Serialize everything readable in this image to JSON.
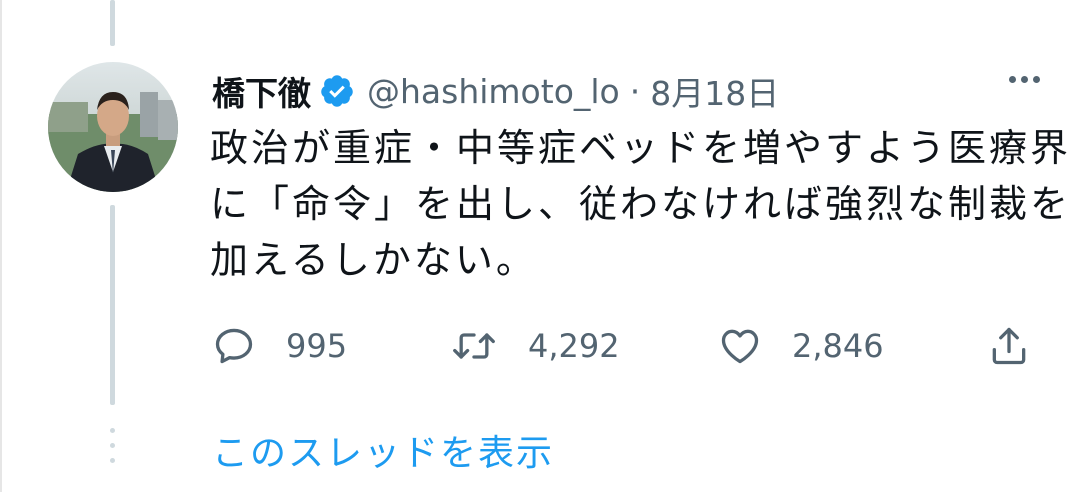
{
  "tweet": {
    "display_name": "橋下徹",
    "handle": "@hashimoto_lo",
    "separator": "·",
    "date": "8月18日",
    "text_lines": [
      "政治が重症・中等症ベッドを増やすよう医療界",
      "に「命令」を出し、従わなければ強烈な制裁を",
      "加えるしかない。"
    ],
    "replies": "995",
    "retweets": "4,292",
    "likes": "2,846"
  },
  "thread": {
    "show_thread_label": "このスレッドを表示"
  },
  "icons": {
    "verified": "verified-badge-icon",
    "more": "more-horizontal-icon",
    "reply": "reply-icon",
    "retweet": "retweet-icon",
    "like": "heart-icon",
    "share": "share-icon"
  },
  "colors": {
    "accent": "#1d9bf0",
    "text_primary": "#0f1419",
    "text_secondary": "#536471",
    "thread_line": "#cfd9de"
  }
}
